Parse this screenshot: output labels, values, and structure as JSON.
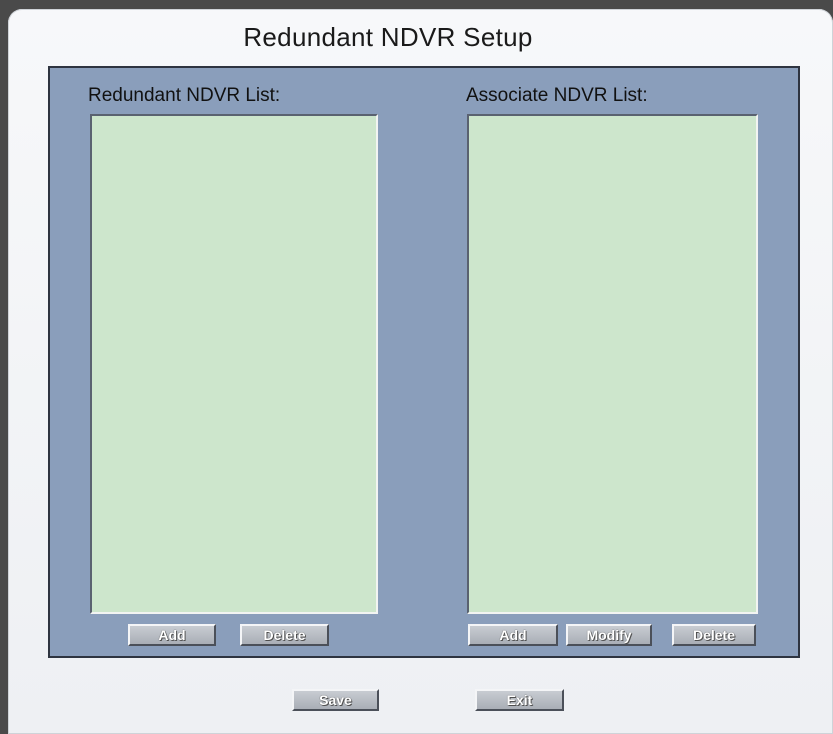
{
  "dialog": {
    "title": "Redundant NDVR Setup"
  },
  "redundant_list": {
    "label": "Redundant NDVR List:",
    "items": [],
    "buttons": {
      "add": "Add",
      "delete": "Delete"
    }
  },
  "associate_list": {
    "label": "Associate NDVR List:",
    "items": [],
    "buttons": {
      "add": "Add",
      "modify": "Modify",
      "delete": "Delete"
    }
  },
  "footer": {
    "save": "Save",
    "exit": "Exit"
  },
  "colors": {
    "panel": "#8a9ebb",
    "listbox": "#cde6cc",
    "button": "#b4b9c0"
  }
}
